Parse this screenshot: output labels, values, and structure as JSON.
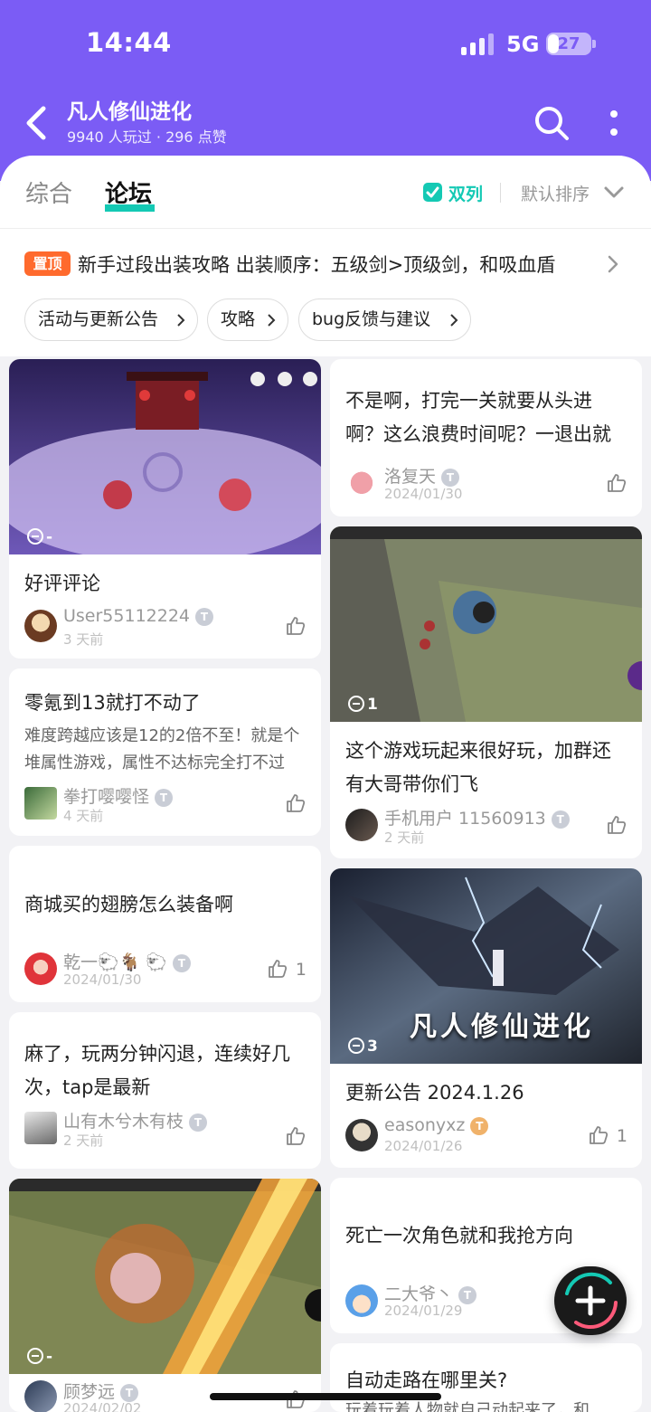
{
  "status": {
    "time": "14:44",
    "network": "5G",
    "battery": "27",
    "battery_level": 0.27
  },
  "header": {
    "title": "凡人修仙进化",
    "stats": "9940 人玩过 · 296 点赞"
  },
  "tabs": {
    "general": "综合",
    "forum": "论坛"
  },
  "view": {
    "dual_column": "双列",
    "sort": "默认排序"
  },
  "pinned": {
    "badge": "置顶",
    "text": "新手过段出装攻略  出装顺序：五级剑>顶级剑，和吸血盾"
  },
  "chips": [
    "活动与更新公告",
    "攻略",
    "bug反馈与建议"
  ],
  "posts_left": [
    {
      "image_counter": "-",
      "title": "好评评论",
      "author": "User55112224",
      "level": "T",
      "date": "3 天前",
      "likes": ""
    },
    {
      "title": "零氪到13就打不动了",
      "desc": "难度跨越应该是12的2倍不至！就是个堆属性游戏，属性不达标完全打不过",
      "author": "拳打嘤嘤怪",
      "level": "T",
      "date": "4 天前",
      "likes": ""
    },
    {
      "title": "商城买的翅膀怎么装备啊",
      "author": "乾一🐑🐐 🐑",
      "level": "T",
      "date": "2024/01/30",
      "likes": "1"
    },
    {
      "title": "麻了，玩两分钟闪退，连续好几次，tap是最新",
      "author": "山有木兮木有枝",
      "level": "T",
      "date": "2 天前",
      "likes": ""
    },
    {
      "image_counter": "-",
      "title": "",
      "author": "顾梦远",
      "level": "T",
      "date": "2024/02/02",
      "likes": ""
    }
  ],
  "posts_right": [
    {
      "title": "不是啊，打完一关就要从头进啊？这么浪费时间呢？一退出就得从头开始",
      "author": "洛复天",
      "level": "T",
      "date": "2024/01/30",
      "likes": ""
    },
    {
      "image_counter": "1",
      "title": "这个游戏玩起来很好玩，加群还有大哥带你们飞",
      "author": "手机用户 11560913",
      "level": "T",
      "date": "2 天前",
      "likes": ""
    },
    {
      "image_counter": "3",
      "image_caption": "凡人修仙进化",
      "title": "更新公告 2024.1.26",
      "author": "easonyxz",
      "level": "T",
      "date": "2024/01/26",
      "likes": "1"
    },
    {
      "title": "死亡一次角色就和我抢方向",
      "author": "二大爷丶",
      "level": "T",
      "date": "2024/01/29",
      "likes": ""
    },
    {
      "title": "自动走路在哪里关?",
      "desc": "玩着玩着人物就自己动起来了，和",
      "author": "",
      "date": "",
      "likes": ""
    }
  ],
  "colors": {
    "brand": "#7b5cf5",
    "accent": "#14c9b4",
    "pin": "#ff6a2d"
  }
}
